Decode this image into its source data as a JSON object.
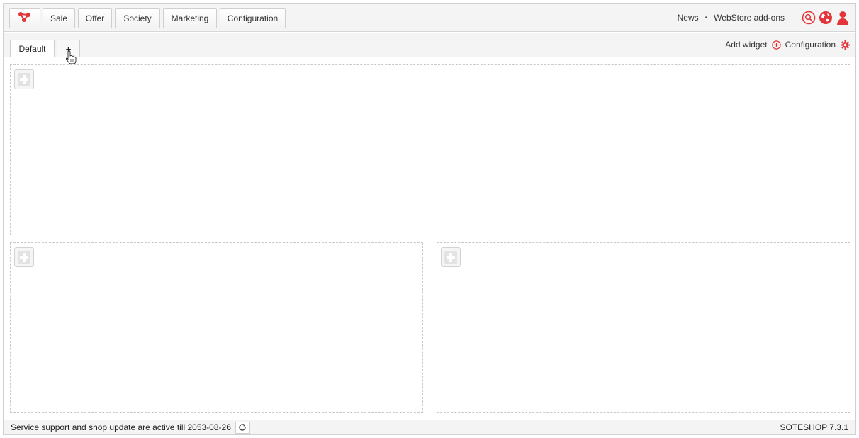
{
  "nav": {
    "logo_icon": "soteshop-logo-icon",
    "items": [
      {
        "label": "Sale"
      },
      {
        "label": "Offer"
      },
      {
        "label": "Society"
      },
      {
        "label": "Marketing"
      },
      {
        "label": "Configuration"
      }
    ],
    "links": {
      "news": "News",
      "separator": "•",
      "webstore": "WebStore add-ons"
    },
    "icons": [
      "search-icon",
      "globe-icon",
      "user-icon"
    ]
  },
  "tabs": {
    "items": [
      {
        "label": "Default"
      },
      {
        "label": "+"
      }
    ],
    "add_widget_label": "Add widget",
    "configuration_label": "Configuration"
  },
  "zones": {
    "add_icon": "plus-square-icon"
  },
  "footer": {
    "status_text": "Service support and shop update are active till 2053-08-26",
    "version": "SOTESHOP 7.3.1"
  },
  "colors": {
    "accent": "#e2353a",
    "border": "#cfcfcf",
    "dashed": "#c9c9c9"
  }
}
